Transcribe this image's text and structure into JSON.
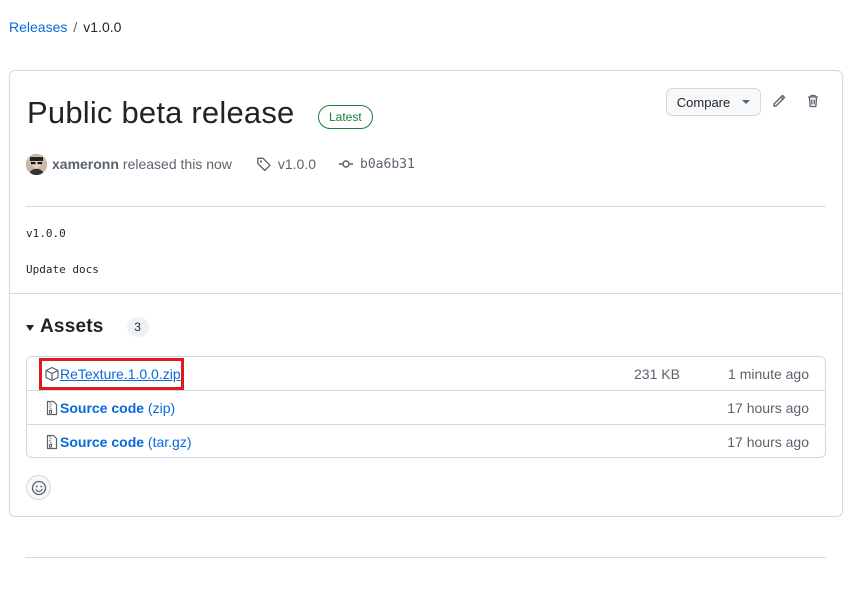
{
  "breadcrumb": {
    "link": "Releases",
    "separator": "/",
    "current": "v1.0.0"
  },
  "release": {
    "title": "Public beta release",
    "badge": "Latest",
    "author": "xameronn",
    "released_text": "released this now",
    "tag": "v1.0.0",
    "commit": "b0a6b31",
    "compare_label": "Compare",
    "body_lines": [
      "v1.0.0",
      "Update docs"
    ]
  },
  "assets": {
    "title": "Assets",
    "count": "3",
    "items": [
      {
        "name": "ReTexture.1.0.0.zip",
        "suffix": "",
        "size": "231 KB",
        "time": "1 minute ago",
        "icon": "package-icon"
      },
      {
        "name": "Source code",
        "suffix": "(zip)",
        "size": "",
        "time": "17 hours ago",
        "icon": "file-zip-icon"
      },
      {
        "name": "Source code",
        "suffix": "(tar.gz)",
        "size": "",
        "time": "17 hours ago",
        "icon": "file-zip-icon"
      }
    ]
  },
  "colors": {
    "link": "#0969da",
    "latest": "#1a7f37",
    "highlight": "#e0191e",
    "border": "#d1d9e0"
  }
}
